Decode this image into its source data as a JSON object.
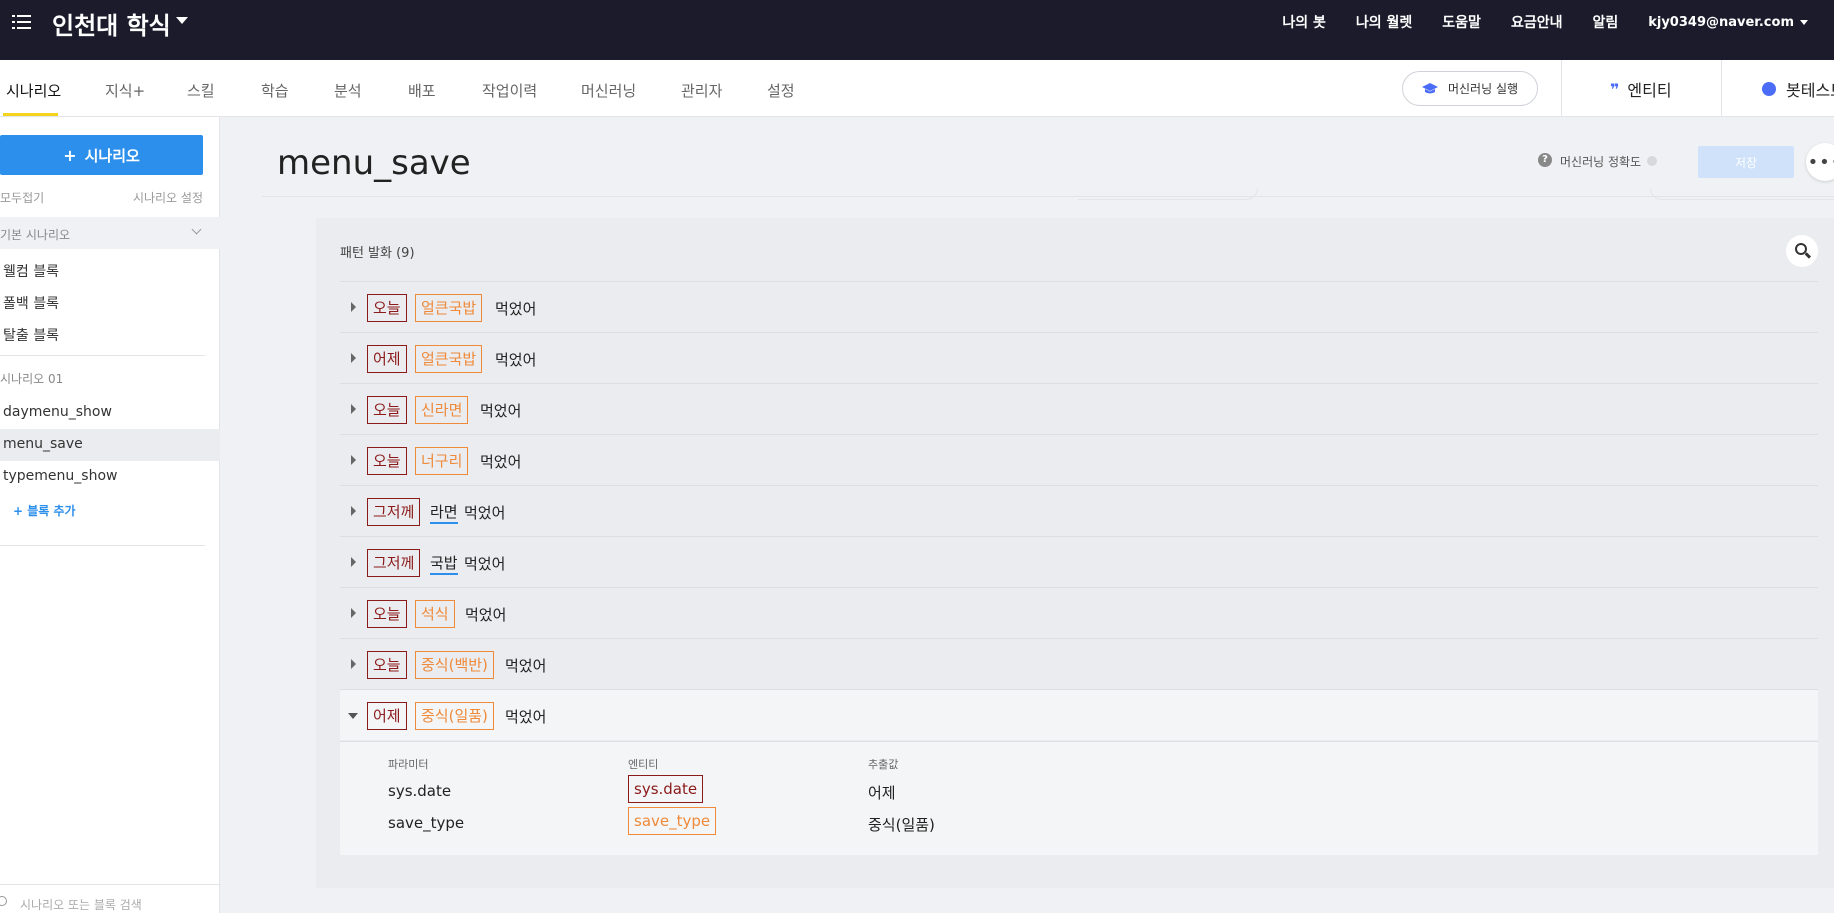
{
  "header": {
    "app_title": "인천대 학식",
    "nav": [
      "나의 봇",
      "나의 월렛",
      "도움말",
      "요금안내",
      "알림"
    ],
    "user_email": "kjy0349@naver.com"
  },
  "tabs": [
    "시나리오",
    "지식+",
    "스킬",
    "학습",
    "분석",
    "배포",
    "작업이력",
    "머신러닝",
    "관리자",
    "설정"
  ],
  "toolbar": {
    "ml_run_label": "머신러닝 실행",
    "entity_label": "엔티티",
    "bottest_label": "봇테스트"
  },
  "sidebar": {
    "add_scenario_label": "시나리오",
    "collapse_all": "모두접기",
    "scenario_settings": "시나리오 설정",
    "default_group": "기본 시나리오",
    "default_items": [
      "웰컴 블록",
      "폴백 블록",
      "탈출 블록"
    ],
    "scenario_group": "시나리오 01",
    "scenario_items": [
      "daymenu_show",
      "menu_save",
      "typemenu_show"
    ],
    "active_item": "menu_save",
    "add_block_label": "+ 블록 추가",
    "search_placeholder": "시나리오 또는 블록 검색"
  },
  "main": {
    "page_title": "menu_save",
    "ml_accuracy_label": "머신러닝 정확도",
    "save_label": "저장",
    "more_label": "•••",
    "panel_title": "패턴 발화 (9)",
    "rows": [
      {
        "date": "오늘",
        "food": "얼큰국밥",
        "rest": "먹었어"
      },
      {
        "date": "어제",
        "food": "얼큰국밥",
        "rest": "먹었어"
      },
      {
        "date": "오늘",
        "food": "신라면",
        "rest": "먹었어"
      },
      {
        "date": "오늘",
        "food": "너구리",
        "rest": "먹었어"
      },
      {
        "date": "그저께",
        "underlined": "라면",
        "rest": "먹었어"
      },
      {
        "date": "그저께",
        "underlined": "국밥",
        "rest": "먹었어"
      },
      {
        "date": "오늘",
        "food": "석식",
        "rest": "먹었어"
      },
      {
        "date": "오늘",
        "food": "중식(백반)",
        "rest": "먹었어"
      },
      {
        "date": "어제",
        "food": "중식(일품)",
        "rest": "먹었어"
      }
    ],
    "detail": {
      "headers": [
        "파라미터",
        "엔티티",
        "추출값"
      ],
      "params": [
        {
          "param": "sys.date",
          "entity": "sys.date",
          "value": "어제"
        },
        {
          "param": "save_type",
          "entity": "save_type",
          "value": "중식(일품)"
        }
      ]
    }
  },
  "colors": {
    "topbar": "#1b1b2b",
    "primary": "#2d8fec",
    "date_entity": "#8b1a1a",
    "food_entity": "#ee8a3a",
    "tab_active_underline": "#f5d41e"
  }
}
